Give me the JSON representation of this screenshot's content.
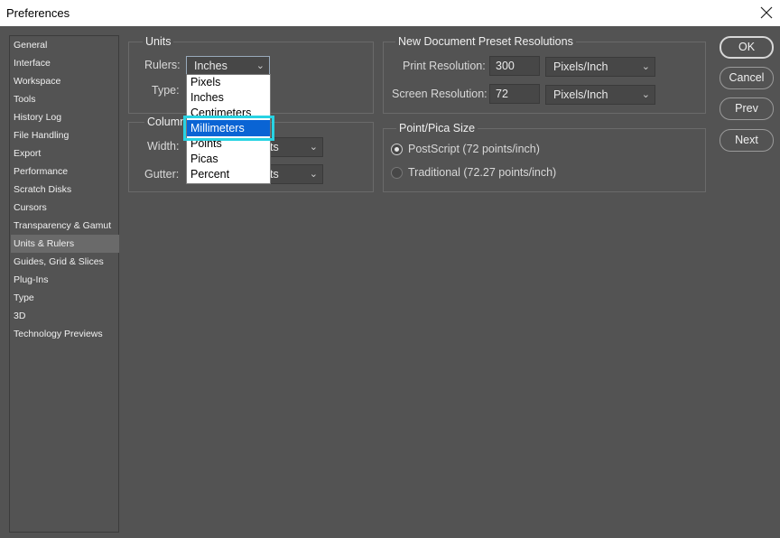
{
  "window": {
    "title": "Preferences"
  },
  "sidebar": {
    "items": [
      {
        "label": "General"
      },
      {
        "label": "Interface"
      },
      {
        "label": "Workspace"
      },
      {
        "label": "Tools"
      },
      {
        "label": "History Log"
      },
      {
        "label": "File Handling"
      },
      {
        "label": "Export"
      },
      {
        "label": "Performance"
      },
      {
        "label": "Scratch Disks"
      },
      {
        "label": "Cursors"
      },
      {
        "label": "Transparency & Gamut"
      },
      {
        "label": "Units & Rulers"
      },
      {
        "label": "Guides, Grid & Slices"
      },
      {
        "label": "Plug-Ins"
      },
      {
        "label": "Type"
      },
      {
        "label": "3D"
      },
      {
        "label": "Technology Previews"
      }
    ],
    "selected": "Units & Rulers"
  },
  "units": {
    "group_label": "Units",
    "rulers_label": "Rulers:",
    "rulers_value": "Inches",
    "type_label": "Type:",
    "dropdown_options": [
      "Pixels",
      "Inches",
      "Centimeters",
      "Millimeters",
      "Points",
      "Picas",
      "Percent"
    ],
    "highlighted_option": "Millimeters"
  },
  "column": {
    "group_label": "Column",
    "width_label": "Width:",
    "width_unit": "ts",
    "gutter_label": "Gutter:",
    "gutter_unit": "ts"
  },
  "resolutions": {
    "group_label": "New Document Preset Resolutions",
    "print_label": "Print Resolution:",
    "print_value": "300",
    "print_unit": "Pixels/Inch",
    "screen_label": "Screen Resolution:",
    "screen_value": "72",
    "screen_unit": "Pixels/Inch"
  },
  "pica": {
    "group_label": "Point/Pica Size",
    "option_postscript": "PostScript (72 points/inch)",
    "option_traditional": "Traditional (72.27 points/inch)",
    "selected": "PostScript (72 points/inch)"
  },
  "buttons": {
    "ok": "OK",
    "cancel": "Cancel",
    "prev": "Prev",
    "next": "Next"
  },
  "icons": {
    "chevron": "⌄",
    "close": "close-icon"
  }
}
